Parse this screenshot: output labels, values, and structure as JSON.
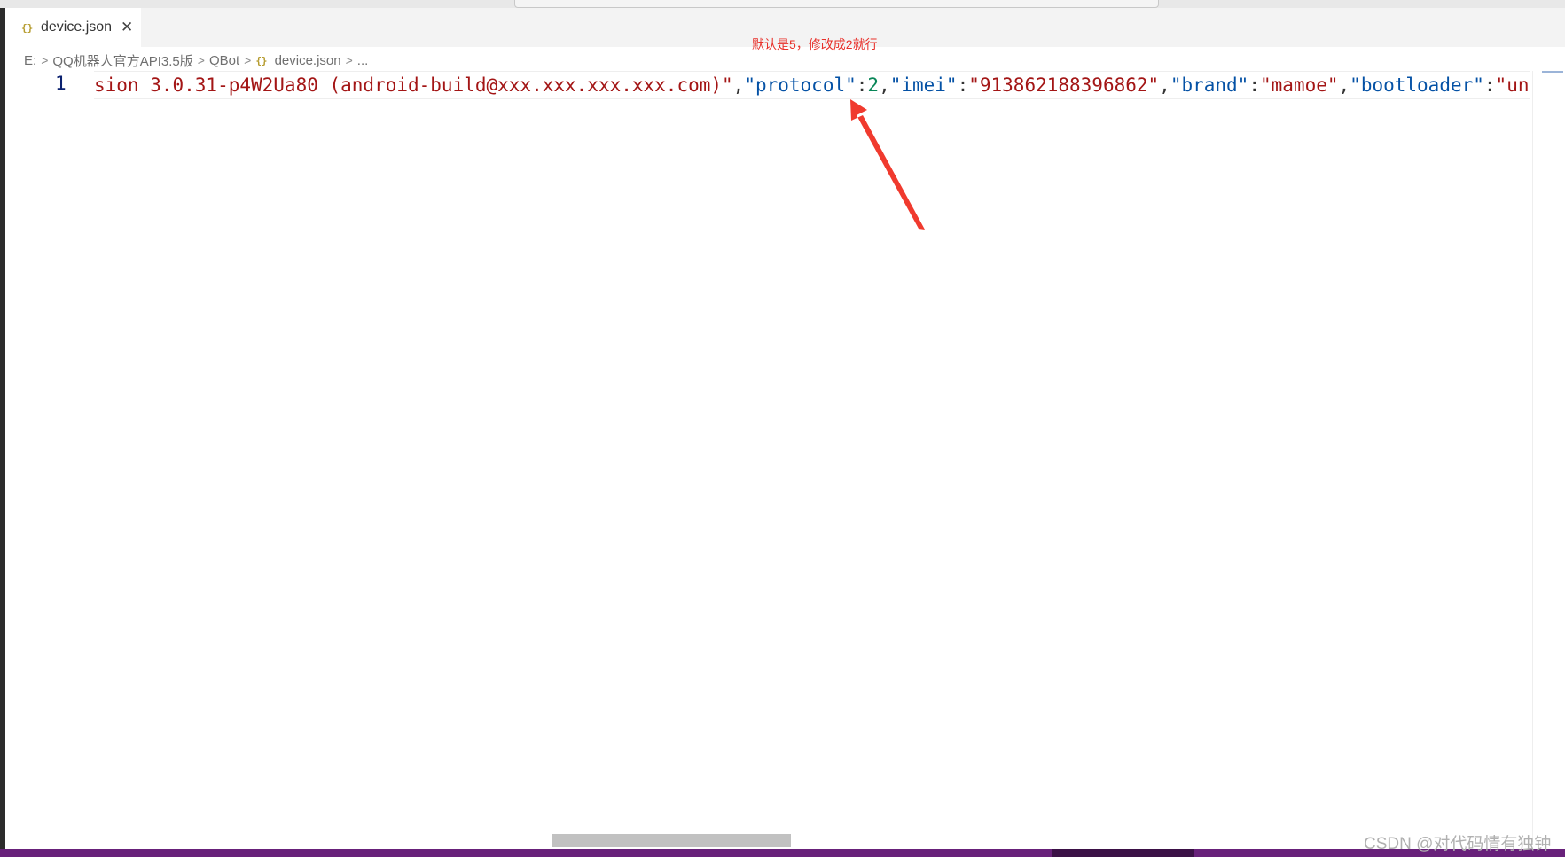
{
  "tab": {
    "icon": "json-braces-icon",
    "icon_glyph": "{}",
    "label": "device.json",
    "close_glyph": "✕"
  },
  "breadcrumb": {
    "drive": "E:",
    "folder1": "QQ机器人官方API3.5版",
    "folder2": "QBot",
    "file_icon_glyph": "{}",
    "file": "device.json",
    "ellipsis": "...",
    "separator": ">"
  },
  "annotation": {
    "text": "默认是5，修改成2就行",
    "color": "#e8302a"
  },
  "editor": {
    "line_number": "1",
    "tokens": {
      "t1": "sion 3.0.31-p4W2Ua80 (android-build@xxx.xxx.xxx.xxx.com)\"",
      "t2": ",",
      "t3": "\"protocol\"",
      "t4": ":",
      "t5": "2",
      "t6": ",",
      "t7": "\"imei\"",
      "t8": ":",
      "t9": "\"913862188396862\"",
      "t10": ",",
      "t11": "\"brand\"",
      "t12": ":",
      "t13": "\"mamoe\"",
      "t14": ",",
      "t15": "\"bootloader\"",
      "t16": ":",
      "t17": "\"unkno"
    }
  },
  "colors": {
    "status_bar": "#68217a",
    "string": "#a31515",
    "key": "#0451a5",
    "number": "#098658"
  },
  "watermark": "CSDN @对代码情有独钟"
}
